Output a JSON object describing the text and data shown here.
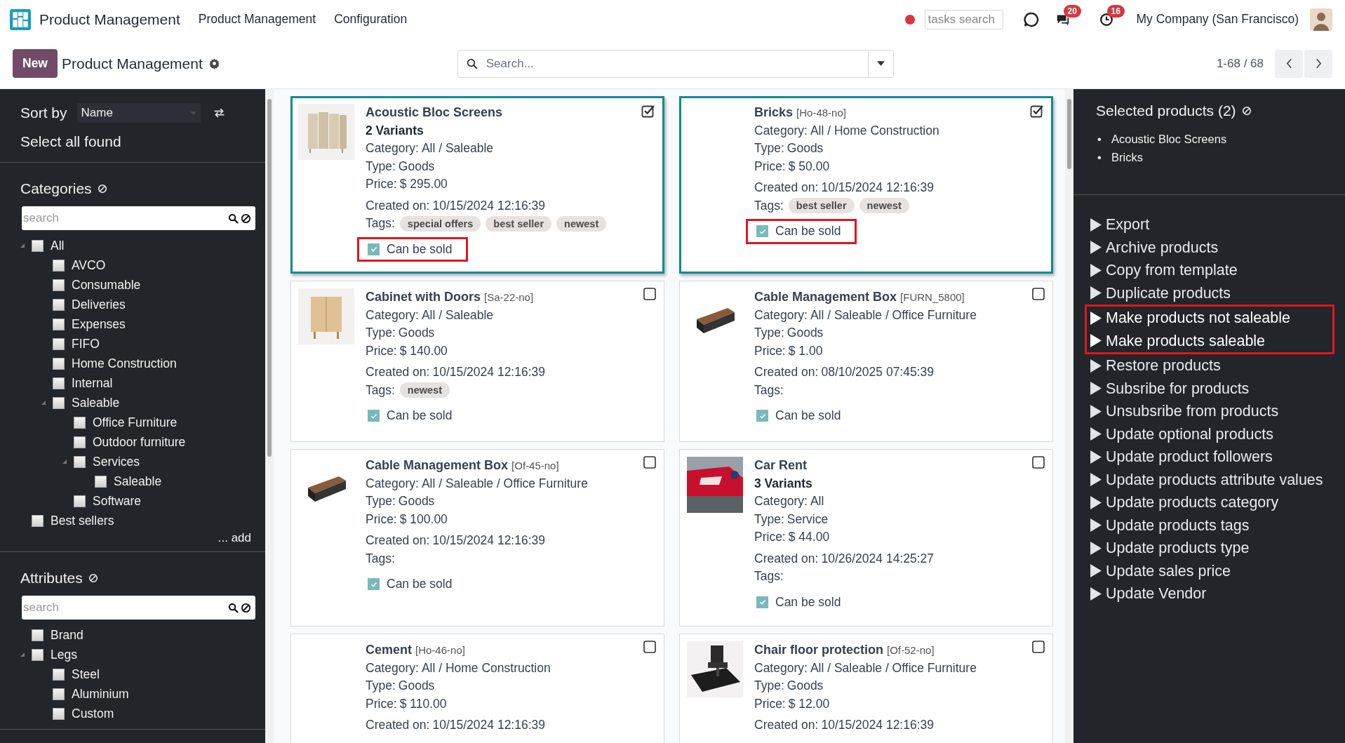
{
  "topbar": {
    "app_name": "Product Management",
    "menu": [
      {
        "label": "Product Management"
      },
      {
        "label": "Configuration"
      }
    ],
    "tasks_search": {
      "placeholder": "tasks search"
    },
    "messages_badge": "20",
    "activities_badge": "16",
    "company": "My Company (San Francisco)"
  },
  "control_bar": {
    "new_button": "New",
    "breadcrumb": "Product Management",
    "search": {
      "placeholder": "Search..."
    },
    "pager": "1-68 / 68"
  },
  "sidebar": {
    "sort_label": "Sort by",
    "sort_value": "Name",
    "select_all": "Select all found",
    "sections": [
      {
        "title": "Categories",
        "search_placeholder": "search",
        "add_link": "... add",
        "tree": [
          {
            "label": "All",
            "checked": false,
            "expanded": true,
            "children": [
              {
                "label": "AVCO",
                "checked": false
              },
              {
                "label": "Consumable",
                "checked": false
              },
              {
                "label": "Deliveries",
                "checked": false
              },
              {
                "label": "Expenses",
                "checked": false
              },
              {
                "label": "FIFO",
                "checked": false
              },
              {
                "label": "Home Construction",
                "checked": false
              },
              {
                "label": "Internal",
                "checked": false
              },
              {
                "label": "Saleable",
                "checked": false,
                "expanded": true,
                "children": [
                  {
                    "label": "Office Furniture",
                    "checked": false
                  },
                  {
                    "label": "Outdoor furniture",
                    "checked": false
                  },
                  {
                    "label": "Services",
                    "checked": false,
                    "expanded": true,
                    "children": [
                      {
                        "label": "Saleable",
                        "checked": false
                      }
                    ]
                  },
                  {
                    "label": "Software",
                    "checked": false
                  }
                ]
              }
            ]
          },
          {
            "label": "Best sellers",
            "checked": false
          }
        ]
      },
      {
        "title": "Attributes",
        "search_placeholder": "search",
        "tree": [
          {
            "label": "Brand",
            "checked": false
          },
          {
            "label": "Legs",
            "checked": false,
            "expanded": true,
            "children": [
              {
                "label": "Steel",
                "checked": false
              },
              {
                "label": "Aluminium",
                "checked": false
              },
              {
                "label": "Custom",
                "checked": false
              }
            ]
          }
        ]
      }
    ]
  },
  "cards": [
    {
      "name": "Acoustic Bloc Screens",
      "variants": "2 Variants",
      "selected": true,
      "thumbnail": {
        "kind": "picture"
      },
      "fields": [
        {
          "label": "Category:",
          "value": "All / Saleable"
        },
        {
          "label": "Type:",
          "value": "Goods"
        },
        {
          "label": "Price:",
          "value": "$ 295.00"
        }
      ],
      "created": {
        "label": "Created on:",
        "value": "10/15/2024 12:16:39"
      },
      "tags_label": "Tags:",
      "tags": [
        "special offers",
        "best seller",
        "newest"
      ],
      "can_be_sold": {
        "label": "Can be sold",
        "checked": true,
        "highlighted": true
      }
    },
    {
      "name": "Bricks",
      "code": "[Ho-48-no]",
      "selected": true,
      "fields": [
        {
          "label": "Category:",
          "value": "All / Home Construction"
        },
        {
          "label": "Type:",
          "value": "Goods"
        },
        {
          "label": "Price:",
          "value": "$ 50.00"
        }
      ],
      "created": {
        "label": "Created on:",
        "value": "10/15/2024 12:16:39"
      },
      "tags_label": "Tags:",
      "tags": [
        "best seller",
        "newest"
      ],
      "can_be_sold": {
        "label": "Can be sold",
        "checked": true,
        "highlighted": true
      }
    },
    {
      "name": "Cabinet with Doors",
      "code": "[Sa-22-no]",
      "selected": false,
      "thumbnail": {
        "kind": "picture"
      },
      "fields": [
        {
          "label": "Category:",
          "value": "All / Saleable"
        },
        {
          "label": "Type:",
          "value": "Goods"
        },
        {
          "label": "Price:",
          "value": "$ 140.00"
        }
      ],
      "created": {
        "label": "Created on:",
        "value": "10/15/2024 12:16:39"
      },
      "tags_label": "Tags:",
      "tags": [
        "newest"
      ],
      "can_be_sold": {
        "label": "Can be sold",
        "checked": true,
        "highlighted": false
      }
    },
    {
      "name": "Cable Management Box",
      "code": "[FURN_5800]",
      "selected": false,
      "thumbnail": {
        "kind": "picture"
      },
      "fields": [
        {
          "label": "Category:",
          "value": "All / Saleable / Office Furniture"
        },
        {
          "label": "Type:",
          "value": "Goods"
        },
        {
          "label": "Price:",
          "value": "$ 1.00"
        }
      ],
      "created": {
        "label": "Created on:",
        "value": "08/10/2025 07:45:39"
      },
      "tags_label": "Tags:",
      "can_be_sold": {
        "label": "Can be sold",
        "checked": true,
        "highlighted": false
      }
    },
    {
      "name": "Cable Management Box",
      "code": "[Of-45-no]",
      "selected": false,
      "thumbnail": {
        "kind": "picture"
      },
      "fields": [
        {
          "label": "Category:",
          "value": "All / Saleable / Office Furniture"
        },
        {
          "label": "Type:",
          "value": "Goods"
        },
        {
          "label": "Price:",
          "value": "$ 100.00"
        }
      ],
      "created": {
        "label": "Created on:",
        "value": "10/15/2024 12:16:39"
      },
      "tags_label": "Tags:",
      "can_be_sold": {
        "label": "Can be sold",
        "checked": true,
        "highlighted": false
      }
    },
    {
      "name": "Car Rent",
      "variants": "3 Variants",
      "selected": false,
      "thumbnail": {
        "kind": "picture"
      },
      "fields": [
        {
          "label": "Category:",
          "value": "All"
        },
        {
          "label": "Type:",
          "value": "Service"
        },
        {
          "label": "Price:",
          "value": "$ 44.00"
        }
      ],
      "created": {
        "label": "Created on:",
        "value": "10/26/2024 14:25:27"
      },
      "tags_label": "Tags:",
      "can_be_sold": {
        "label": "Can be sold",
        "checked": true,
        "highlighted": false
      }
    },
    {
      "name": "Cement",
      "code": "[Ho-46-no]",
      "selected": false,
      "fields": [
        {
          "label": "Category:",
          "value": "All / Home Construction"
        },
        {
          "label": "Type:",
          "value": "Goods"
        },
        {
          "label": "Price:",
          "value": "$ 110.00"
        }
      ],
      "created": {
        "label": "Created on:",
        "value": "10/15/2024 12:16:39"
      }
    },
    {
      "name": "Chair floor protection",
      "code": "[Of-52-no]",
      "selected": false,
      "thumbnail": {
        "kind": "picture"
      },
      "fields": [
        {
          "label": "Category:",
          "value": "All / Saleable / Office Furniture"
        },
        {
          "label": "Type:",
          "value": "Goods"
        },
        {
          "label": "Price:",
          "value": "$ 12.00"
        }
      ],
      "created": {
        "label": "Created on:",
        "value": "10/15/2024 12:16:39"
      }
    }
  ],
  "selection_panel": {
    "title": "Selected products (2)",
    "items": [
      {
        "bullet": "•",
        "label": "Acoustic Bloc Screens"
      },
      {
        "bullet": "•",
        "label": "Bricks"
      }
    ],
    "actions": [
      {
        "label": "Export",
        "highlighted": false
      },
      {
        "label": "Archive products",
        "highlighted": false
      },
      {
        "label": "Copy from template",
        "highlighted": false
      },
      {
        "label": "Duplicate products",
        "highlighted": false
      },
      {
        "label": "Make products not saleable",
        "highlighted": true
      },
      {
        "label": "Make products saleable",
        "highlighted": true
      },
      {
        "label": "Restore products",
        "highlighted": false
      },
      {
        "label": "Subsribe for products",
        "highlighted": false
      },
      {
        "label": "Unsubsribe from products",
        "highlighted": false
      },
      {
        "label": "Update optional products",
        "highlighted": false
      },
      {
        "label": "Update product followers",
        "highlighted": false
      },
      {
        "label": "Update products attribute values",
        "highlighted": false
      },
      {
        "label": "Update products category",
        "highlighted": false
      },
      {
        "label": "Update products tags",
        "highlighted": false
      },
      {
        "label": "Update products type",
        "highlighted": false
      },
      {
        "label": "Update sales price",
        "highlighted": false
      },
      {
        "label": "Update Vendor",
        "highlighted": false
      }
    ]
  }
}
